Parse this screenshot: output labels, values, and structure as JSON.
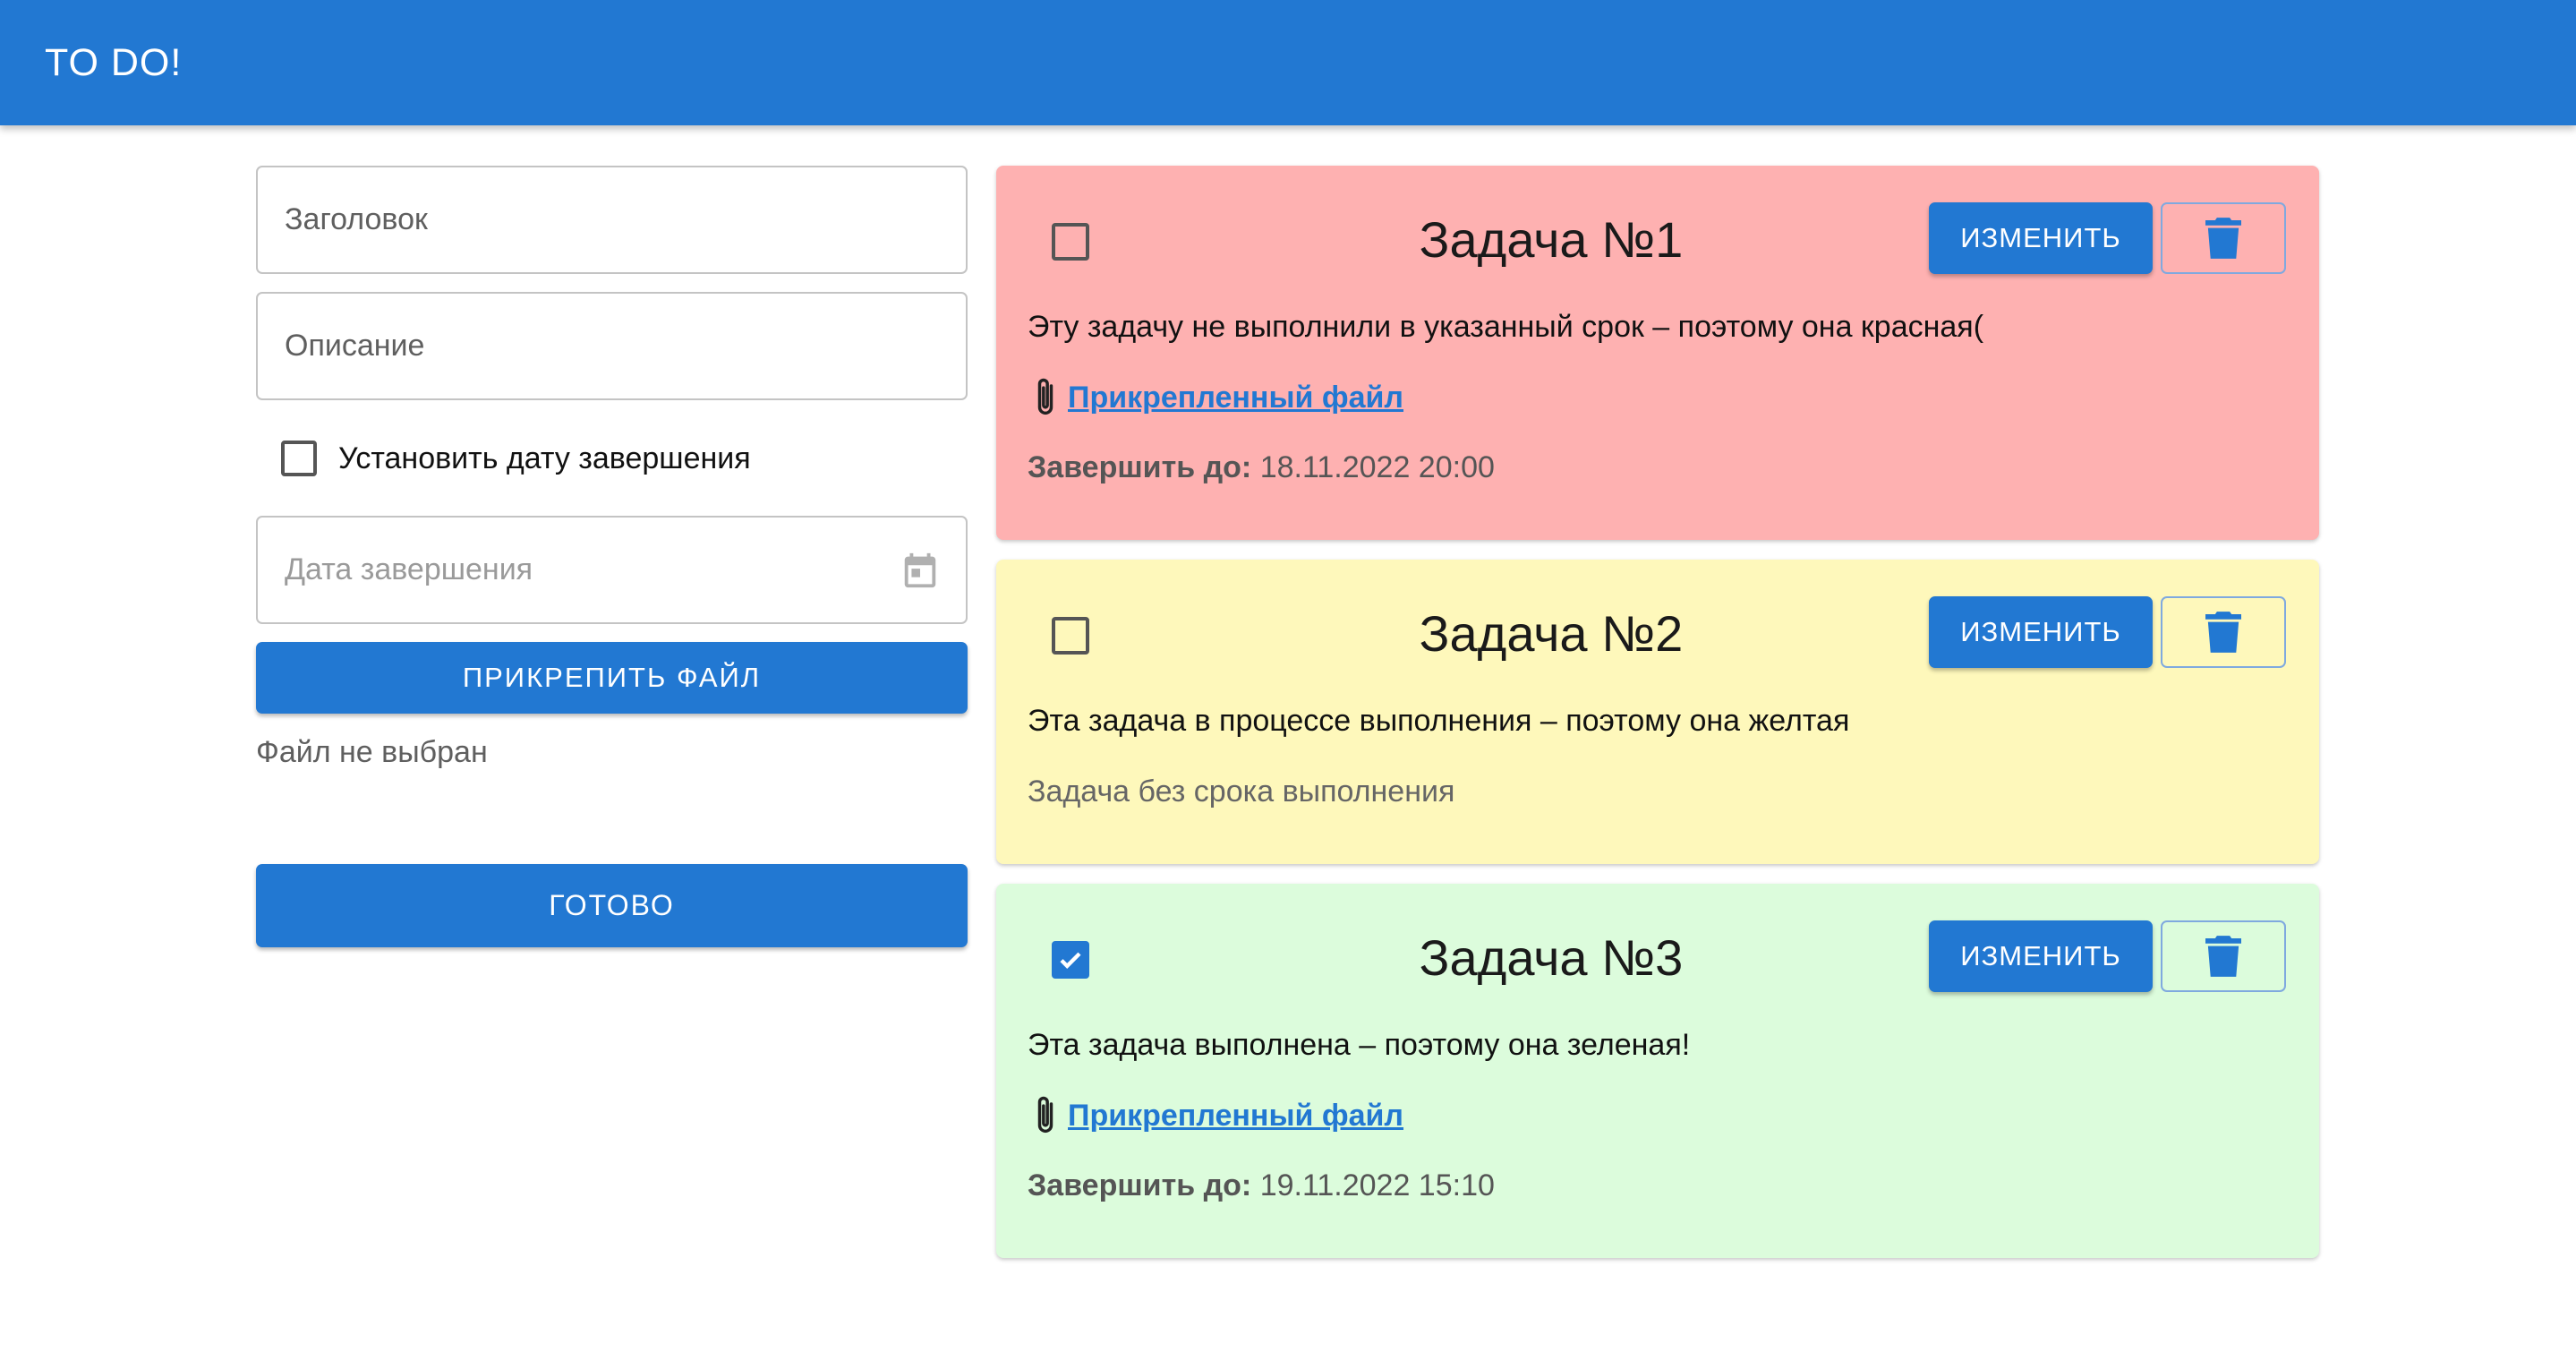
{
  "appbar": {
    "title": "TO DO!"
  },
  "form": {
    "title_placeholder": "Заголовок",
    "description_placeholder": "Описание",
    "set_due_date_label": "Установить дату завершения",
    "set_due_date_checked": false,
    "due_date_placeholder": "Дата завершения",
    "attach_button": "ПРИКРЕПИТЬ ФАЙЛ",
    "file_status": "Файл не выбран",
    "done_button": "ГОТОВО"
  },
  "tasks": [
    {
      "status": "overdue",
      "color": "#feb1b1",
      "checked": false,
      "title": "Задача №1",
      "description": "Эту задачу не выполнили в указанный срок – поэтому она красная(",
      "attachment_label": "Прикрепленный файл",
      "due_label": "Завершить до:",
      "due_value": "18.11.2022 20:00",
      "edit_button": "ИЗМЕНИТЬ",
      "delete_icon": "trash-icon"
    },
    {
      "status": "in-progress",
      "color": "#fef8bb",
      "checked": false,
      "title": "Задача №2",
      "description": "Эта задача в процессе выполнения – поэтому она желтая",
      "no_due_text": "Задача без срока выполнения",
      "edit_button": "ИЗМЕНИТЬ",
      "delete_icon": "trash-icon"
    },
    {
      "status": "completed",
      "color": "#dcfcdc",
      "checked": true,
      "title": "Задача №3",
      "description": "Эта задача выполнена – поэтому она зеленая!",
      "attachment_label": "Прикрепленный файл",
      "due_label": "Завершить до:",
      "due_value": "19.11.2022 15:10",
      "edit_button": "ИЗМЕНИТЬ",
      "delete_icon": "trash-icon"
    }
  ],
  "colors": {
    "primary": "#2278d2",
    "overdue": "#feb1b1",
    "in_progress": "#fef8bb",
    "completed": "#dcfcdc"
  }
}
